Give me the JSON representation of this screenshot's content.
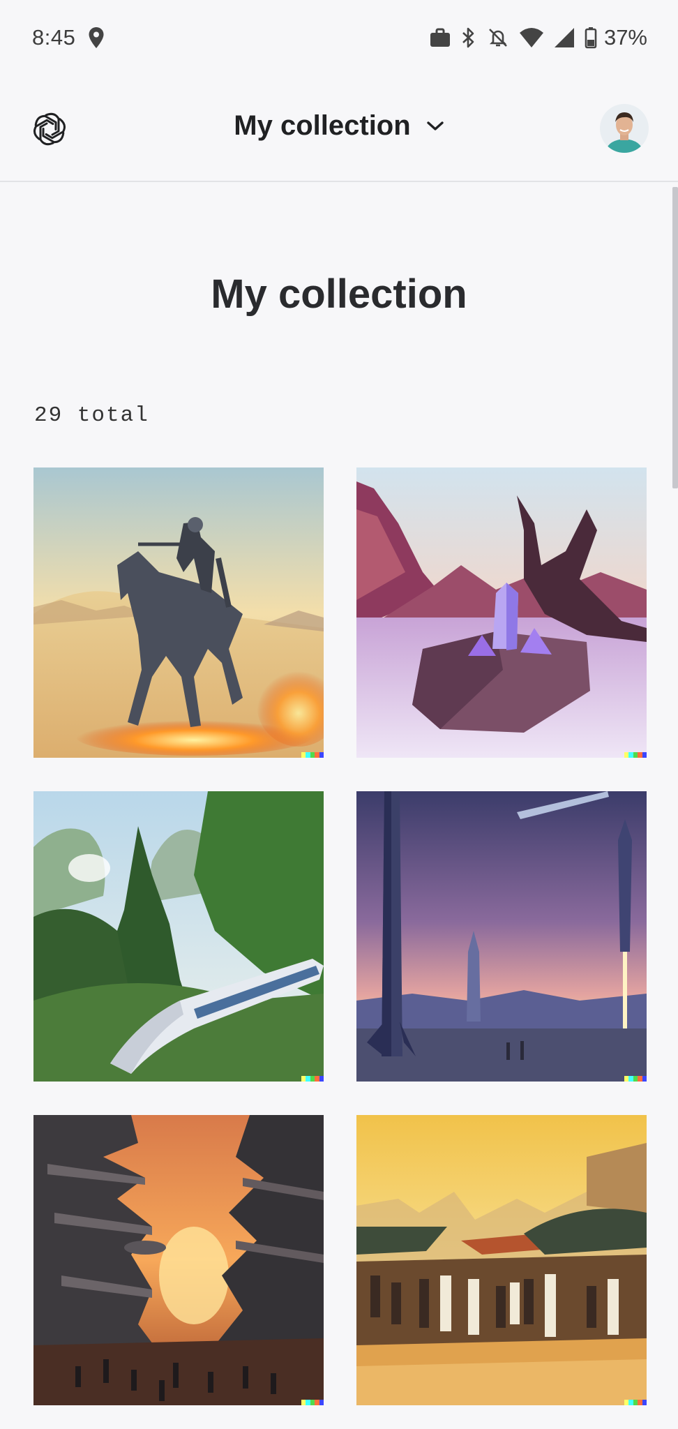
{
  "status_bar": {
    "time": "8:45",
    "battery": "37%",
    "icons": [
      "location-icon",
      "briefcase-icon",
      "bluetooth-icon",
      "notifications-off-icon",
      "wifi-icon",
      "cell-signal-icon",
      "battery-icon"
    ]
  },
  "header": {
    "title": "My collection",
    "logo_icon": "openai-logo",
    "dropdown_icon": "chevron-down-icon"
  },
  "main": {
    "heading": "My collection",
    "total": "29 total"
  },
  "colors": {
    "background": "#f7f7f9",
    "text": "#202123",
    "divider": "#e2e3e6",
    "signature": [
      "#ffff66",
      "#42ffff",
      "#51da4c",
      "#ff6e3c",
      "#3c46ff"
    ]
  }
}
